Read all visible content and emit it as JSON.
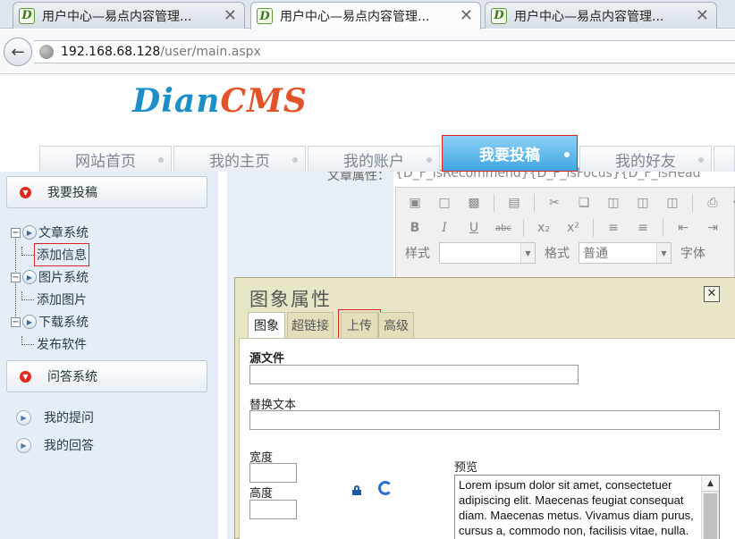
{
  "browser": {
    "tabs": [
      {
        "title": "用户中心—易点内容管理...",
        "active": false
      },
      {
        "title": "用户中心—易点内容管理...",
        "active": true
      },
      {
        "title": "用户中心—易点内容管理...",
        "active": false
      }
    ],
    "favicon_letter": "D",
    "close_glyph": "✕",
    "url_host": "192.168.68.128",
    "url_path": "/user/main.aspx"
  },
  "logo": {
    "part1": "Dian",
    "part2": "CMS"
  },
  "nav": [
    {
      "label": "网站首页"
    },
    {
      "label": "我的主页"
    },
    {
      "label": "我的账户"
    },
    {
      "label": "我要投稿",
      "active": true
    },
    {
      "label": "我的好友"
    }
  ],
  "sidebar": {
    "panel1_title": "我要投稿",
    "tree": [
      {
        "label": "文章系统",
        "children": [
          "添加信息"
        ]
      },
      {
        "label": "图片系统",
        "children": [
          "添加图片"
        ]
      },
      {
        "label": "下载系统",
        "children": [
          "发布软件"
        ]
      }
    ],
    "panel2_title": "问答系统",
    "qa_items": [
      "我的提问",
      "我的回答"
    ]
  },
  "article": {
    "attr_label": "文章属性：",
    "attr_value": "{D_F_IsRecommend}{D_F_IsFocus}{D_F_IsHead"
  },
  "editor": {
    "style_label": "样式",
    "style_value": "",
    "format_label": "格式",
    "format_value": "普通",
    "font_label": "字体"
  },
  "dialog": {
    "title": "图象属性",
    "close_glyph": "✕",
    "tabs": [
      "图象",
      "超链接",
      "上传",
      "高级"
    ],
    "source_label": "源文件",
    "alt_label": "替换文本",
    "width_label": "宽度",
    "height_label": "高度",
    "preview_label": "预览",
    "preview_text": "Lorem ipsum dolor sit amet, consectetuer adipiscing elit. Maecenas feugiat consequat diam. Maecenas metus. Vivamus diam purus, cursus a, commodo non, facilisis vitae, nulla. Aenean dictum"
  },
  "colors": {
    "accent_blue": "#3ea6e2",
    "highlight_red": "#dd2222",
    "dialog_bg": "#e9e6c7"
  }
}
